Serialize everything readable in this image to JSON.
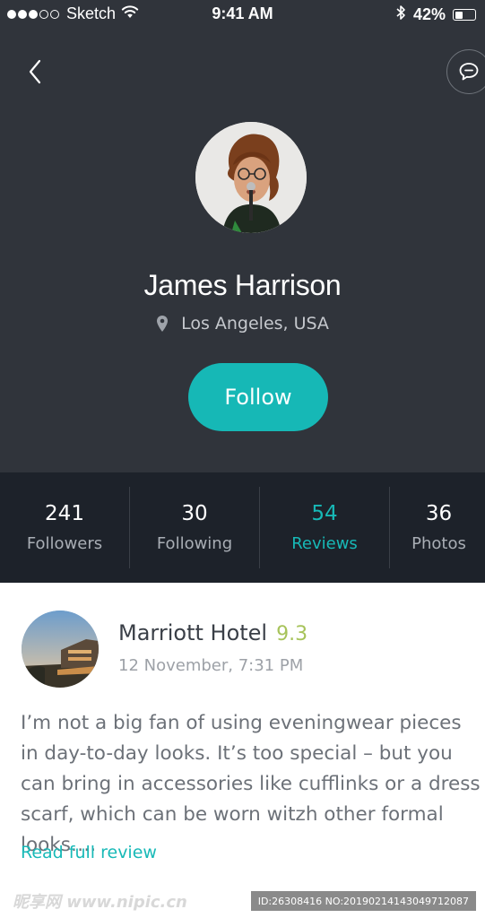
{
  "status_bar": {
    "carrier": "Sketch",
    "time": "9:41 AM",
    "battery_percent": "42%",
    "battery_level": 0.42,
    "icons": [
      "signal-dots-icon",
      "wifi-icon",
      "bluetooth-icon",
      "battery-icon"
    ]
  },
  "nav": {
    "back_icon": "chevron-left-icon",
    "message_icon": "chat-bubble-icon"
  },
  "profile": {
    "name": "James Harrison",
    "location": "Los Angeles, USA",
    "location_icon": "map-pin-icon",
    "follow_label": "Follow"
  },
  "stats": [
    {
      "value": "241",
      "label": "Followers",
      "active": false
    },
    {
      "value": "30",
      "label": "Following",
      "active": false
    },
    {
      "value": "54",
      "label": "Reviews",
      "active": true
    },
    {
      "value": "36",
      "label": "Photos",
      "active": false
    }
  ],
  "review": {
    "place": "Marriott Hotel",
    "rating": "9.3",
    "date": "12 November, 7:31 PM",
    "text": "I’m not a big fan of using eveningwear pieces in day-to-day looks. It’s too special – but you can bring in accessories like cufflinks or a dress scarf, which can be worn witzh other formal looks….",
    "read_more": "Read full review"
  },
  "watermark": {
    "left": "昵享网 www.nipic.cn",
    "right": "ID:26308416 NO:20190214143049712087"
  },
  "colors": {
    "header_bg": "#30343b",
    "stats_bg": "#1d222a",
    "accent": "#17b9b7",
    "rating": "#a7c35a"
  }
}
